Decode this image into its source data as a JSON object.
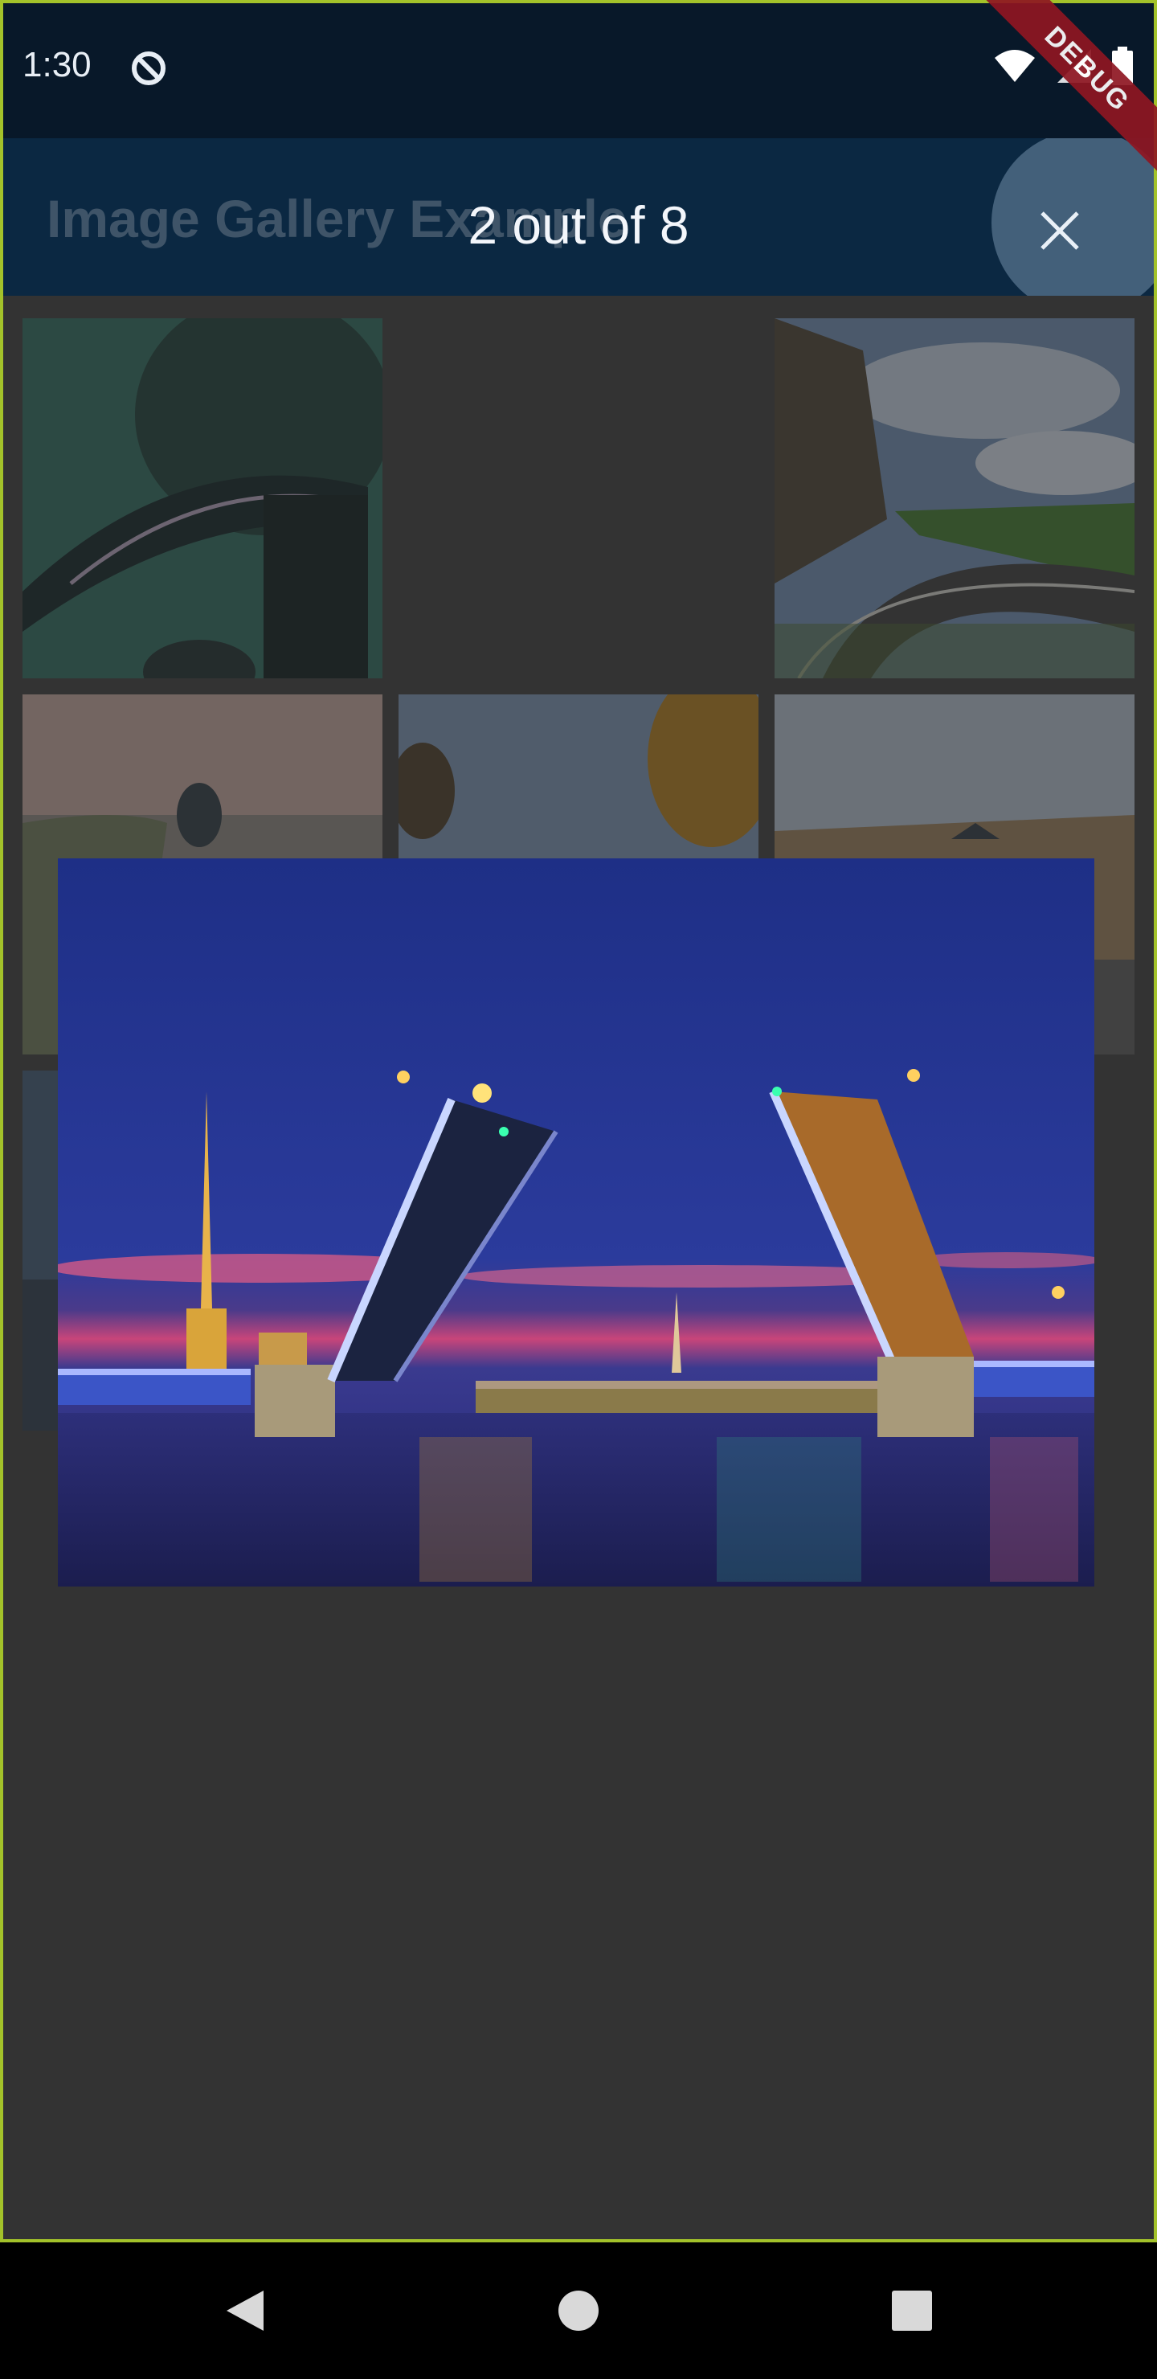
{
  "status_bar": {
    "time": "1:30",
    "icons": [
      "sync-ring-icon",
      "wifi-icon",
      "signal-icon",
      "battery-icon"
    ]
  },
  "debug_banner": "DEBUG",
  "app_bar": {
    "title": "Image Gallery Example",
    "viewer_counter": "2 out of 8",
    "close_icon": "close-icon"
  },
  "gallery": {
    "photo_count": 8,
    "current_index": 2
  },
  "colors": {
    "status_bar": "#081829",
    "app_bar": "#0b2842",
    "frame_border": "#a3c22a",
    "debug_ribbon": "#8f1622",
    "close_button_bg": "#43607a",
    "page_bg": "#3b3b3b"
  },
  "nav_bar": {
    "icons": [
      "back-icon",
      "home-icon",
      "recents-icon"
    ]
  }
}
